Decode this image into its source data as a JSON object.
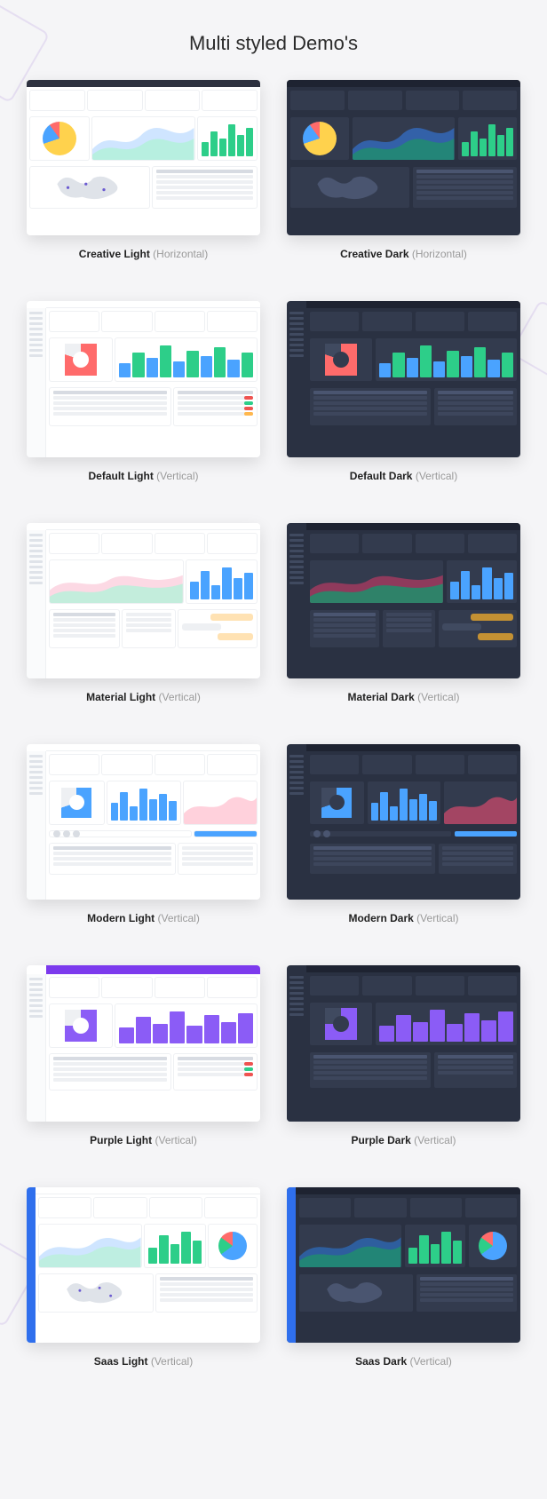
{
  "title": "Multi styled Demo's",
  "demos": [
    {
      "name": "Creative Light",
      "layout": "Horizontal"
    },
    {
      "name": "Creative Dark",
      "layout": "Horizontal"
    },
    {
      "name": "Default Light",
      "layout": "Vertical"
    },
    {
      "name": "Default Dark",
      "layout": "Vertical"
    },
    {
      "name": "Material Light",
      "layout": "Vertical"
    },
    {
      "name": "Material Dark",
      "layout": "Vertical"
    },
    {
      "name": "Modern Light",
      "layout": "Vertical"
    },
    {
      "name": "Modern Dark",
      "layout": "Vertical"
    },
    {
      "name": "Purple Light",
      "layout": "Vertical"
    },
    {
      "name": "Purple Dark",
      "layout": "Vertical"
    },
    {
      "name": "Saas Light",
      "layout": "Vertical"
    },
    {
      "name": "Saas Dark",
      "layout": "Vertical"
    }
  ]
}
